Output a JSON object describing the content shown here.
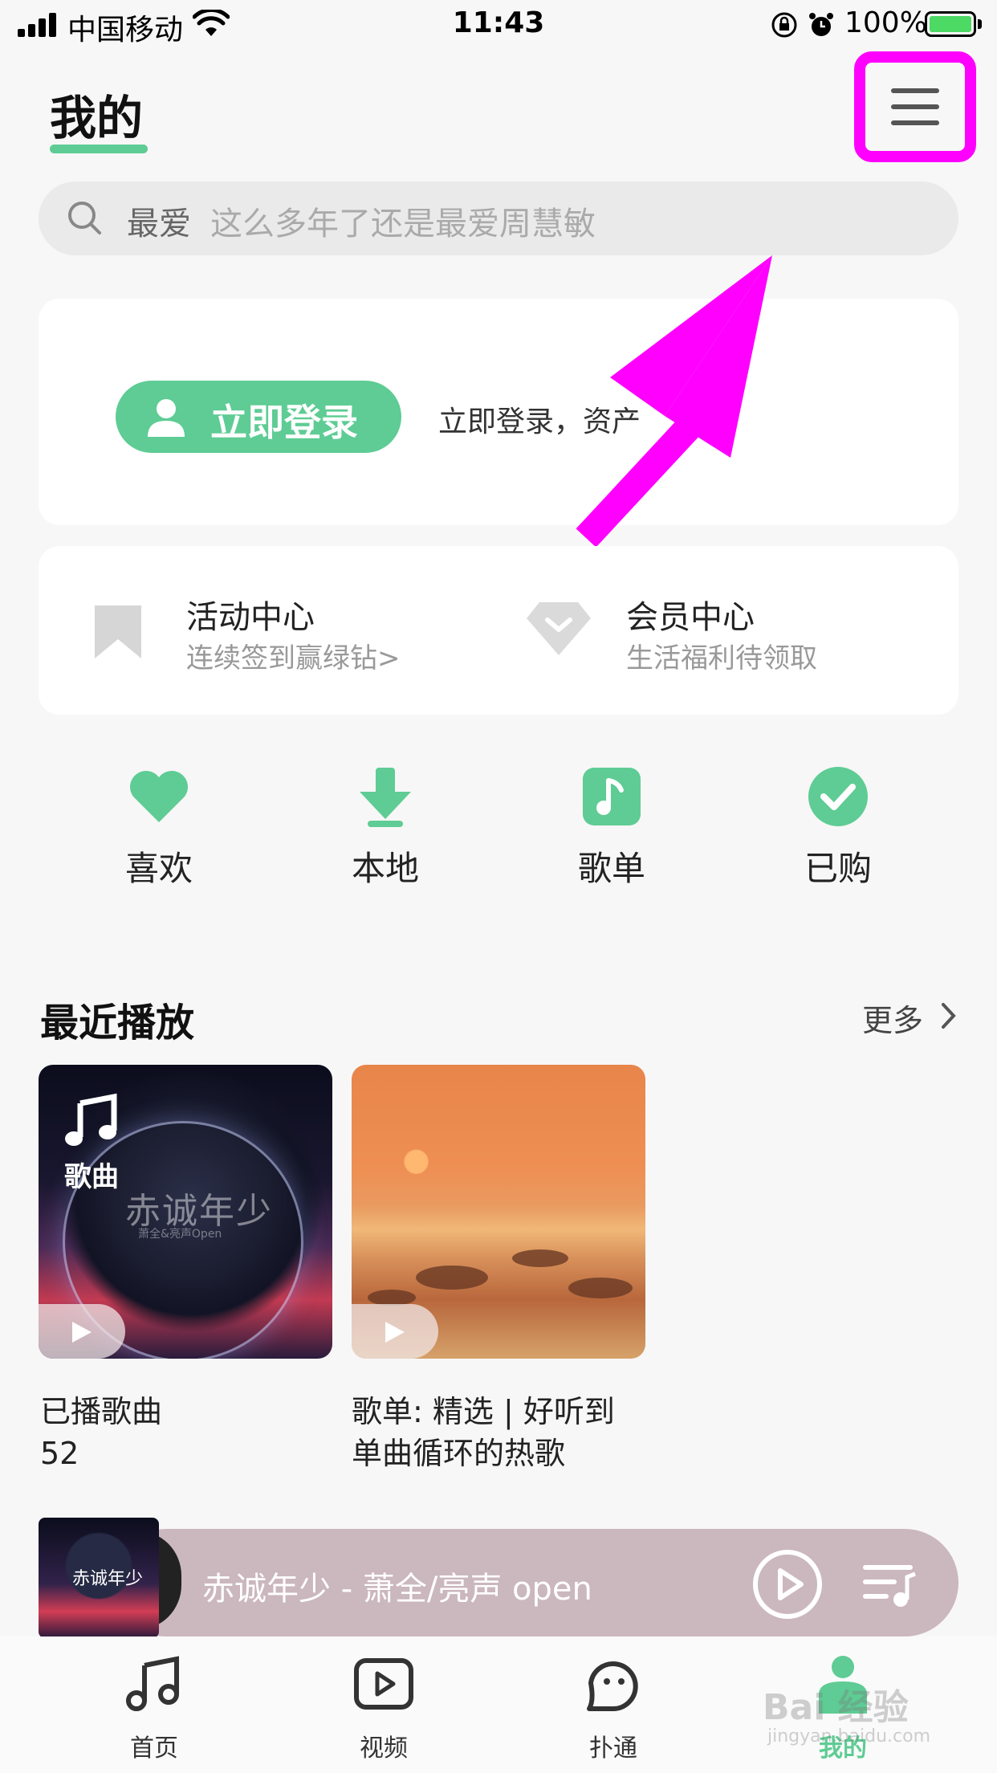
{
  "status_bar": {
    "carrier": "中国移动",
    "time": "11:43",
    "battery": "100%"
  },
  "header": {
    "title": "我的",
    "menu_icon": "hamburger-menu-icon"
  },
  "search": {
    "keyword": "最爱",
    "placeholder": "这么多年了还是最爱周慧敏"
  },
  "login": {
    "button_label": "立即登录",
    "hint": "立即登录，资产"
  },
  "centers": [
    {
      "title": "活动中心",
      "subtitle": "连续签到赢绿钻>",
      "icon": "bookmark-icon"
    },
    {
      "title": "会员中心",
      "subtitle": "生活福利待领取",
      "icon": "diamond-icon"
    }
  ],
  "quick_actions": [
    {
      "label": "喜欢",
      "icon": "heart-icon"
    },
    {
      "label": "本地",
      "icon": "download-icon"
    },
    {
      "label": "歌单",
      "icon": "music-note-icon"
    },
    {
      "label": "已购",
      "icon": "check-circle-icon"
    }
  ],
  "recent": {
    "title": "最近播放",
    "more": "更多",
    "items": [
      {
        "tag": "歌曲",
        "art_title": "赤诚年少",
        "art_subtitle": "萧全&亮声Open",
        "caption_line1": "已播歌曲",
        "caption_line2": "52"
      },
      {
        "caption_line1": "歌单: 精选 | 好听到",
        "caption_line2": "单曲循环的热歌"
      }
    ]
  },
  "player": {
    "now_playing": "赤诚年少 - 萧全/亮声 open",
    "thumb_title": "赤诚年少"
  },
  "tabs": [
    {
      "label": "首页",
      "icon": "music-note-icon"
    },
    {
      "label": "视频",
      "icon": "video-play-icon"
    },
    {
      "label": "扑通",
      "icon": "chat-face-icon"
    },
    {
      "label": "我的",
      "icon": "profile-icon"
    }
  ],
  "watermark": {
    "text": "Bai 经验",
    "sub": "jingyan.baidu.com"
  },
  "colors": {
    "accent": "#5ecc94",
    "annotation": "#ff00ff"
  }
}
